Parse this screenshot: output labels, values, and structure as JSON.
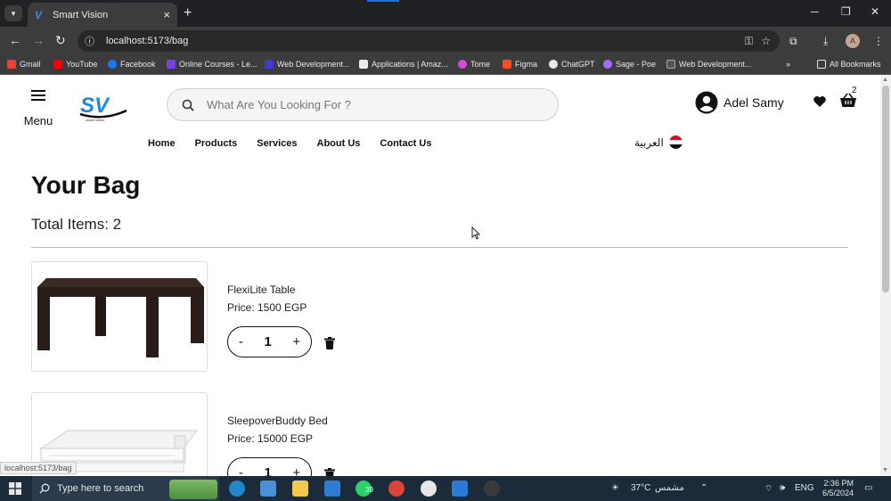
{
  "browser": {
    "tab_title": "Smart Vision",
    "url": "localhost:5173/bag",
    "bookmarks": [
      "Gmail",
      "YouTube",
      "Facebook",
      "Online Courses - Le...",
      "Web Development...",
      "Applications | Amaz...",
      "Tome",
      "Figma",
      "ChatGPT",
      "Sage - Poe",
      "Web Development..."
    ],
    "all_bookmarks": "All Bookmarks",
    "avatar_letter": "A"
  },
  "header": {
    "menu_label": "Menu",
    "logo_text": "SV",
    "logo_sub": "smart vision",
    "search_placeholder": "What Are You Looking For ?",
    "user_name": "Adel Samy",
    "cart_count": "2",
    "language": "العربية"
  },
  "nav": [
    "Home",
    "Products",
    "Services",
    "About Us",
    "Contact Us"
  ],
  "bag": {
    "title": "Your Bag",
    "total_label": "Total Items: 2",
    "items": [
      {
        "name": "FlexiLite Table",
        "price": "Price: 1500 EGP",
        "qty": "1"
      },
      {
        "name": "SleepoverBuddy Bed",
        "price": "Price: 15000 EGP",
        "qty": "1"
      }
    ]
  },
  "status_bar_url": "localhost:5173/bag",
  "taskbar": {
    "search_text": "Type here to search",
    "whatsapp_badge": "39",
    "weather": "37°C",
    "weather_label": "مشمس",
    "lang": "ENG",
    "time": "2:36 PM",
    "date": "6/5/2024"
  },
  "colors": {
    "brand_blue": "#1e88e5",
    "chrome_dark": "#202124",
    "taskbar": "#1c2b3a"
  }
}
